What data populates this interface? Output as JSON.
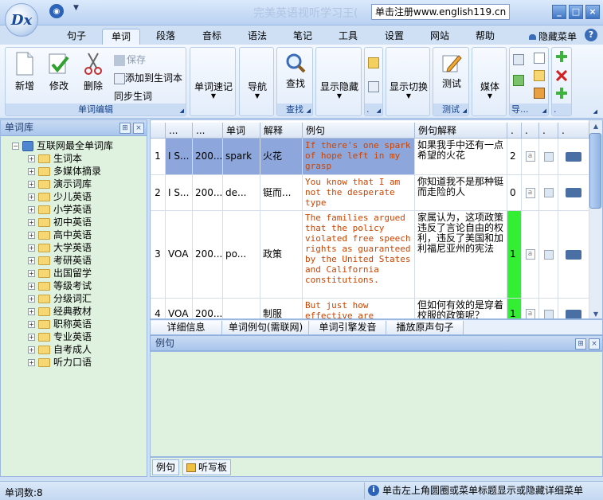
{
  "app": {
    "title": "完美英语视听学习王(",
    "register": "单击注册www.english119.cn",
    "logo": "Dx"
  },
  "menu": [
    "句子",
    "单词",
    "段落",
    "音标",
    "语法",
    "笔记",
    "工具",
    "设置",
    "网站",
    "帮助"
  ],
  "hide_menu": "隐藏菜单",
  "ribbon": {
    "g1": {
      "label": "单词编辑",
      "new": "新增",
      "edit": "修改",
      "delete": "删除",
      "save": "保存",
      "add_vocab": "添加到生词本",
      "sync_vocab": "同步生词"
    },
    "g2": {
      "label": "单词速记"
    },
    "g3": {
      "label": "导航"
    },
    "g4": {
      "label": "查找",
      "find": "查找"
    },
    "g5": {
      "label": "显示隐藏"
    },
    "g6": {
      "label": "."
    },
    "g7": {
      "label": "显示切换"
    },
    "g8": {
      "label": "测试",
      "test": "测试"
    },
    "g9": {
      "label": "媒体"
    },
    "g10": {
      "label": "导..."
    },
    "g11": {
      "label": "."
    }
  },
  "left": {
    "header": "单词库",
    "root": "互联网最全单词库",
    "items": [
      "生词本",
      "多媒体摘录",
      "演示词库",
      "少儿英语",
      "小学英语",
      "初中英语",
      "高中英语",
      "大学英语",
      "考研英语",
      "出国留学",
      "等级考试",
      "分级词汇",
      "经典教材",
      "职称英语",
      "专业英语",
      "自考成人",
      "听力口语"
    ]
  },
  "grid": {
    "headers": [
      "...",
      "...",
      "单词",
      "解释",
      "例句",
      "例句解释",
      ".",
      ".",
      ".",
      "."
    ],
    "rows": [
      {
        "num": "1",
        "c1": "I S...",
        "c2": "200...",
        "word": "spark",
        "mean": "火花",
        "ex": "If there's one spark of hope left in my grasp",
        "exmean": "如果我手中还有一点希望的火花",
        "n": "2"
      },
      {
        "num": "2",
        "c1": "I S...",
        "c2": "200...",
        "word": "de...",
        "mean": "铤而...",
        "ex": "You know that I am not the desperate type",
        "exmean": "你知道我不是那种铤而走险的人",
        "n": "0"
      },
      {
        "num": "3",
        "c1": "VOA",
        "c2": "200...",
        "word": "po...",
        "mean": "政策",
        "ex": "The families argued that the policy violated free speech rights as guaranteed by the United States and California constitutions.",
        "exmean": "家属认为，这项政策违反了言论自由的权利，违反了美国和加利福尼亚州的宪法",
        "n": "1"
      },
      {
        "num": "4",
        "c1": "VOA",
        "c2": "200...",
        "word": "",
        "mean": "制服",
        "ex": "But just how effective are",
        "exmean": "但如何有效的是穿着校服的政策呢？",
        "n": "1"
      }
    ]
  },
  "bottom_tabs": [
    "详细信息",
    "单词例句(需联网)",
    "单词引擎发音",
    "播放原声句子"
  ],
  "example": {
    "header": "例句",
    "tabs": [
      "例句",
      "听写板"
    ]
  },
  "status": {
    "count": "单词数:8",
    "message": "单击左上角圆圈或菜单标题显示或隐藏详细菜单"
  }
}
